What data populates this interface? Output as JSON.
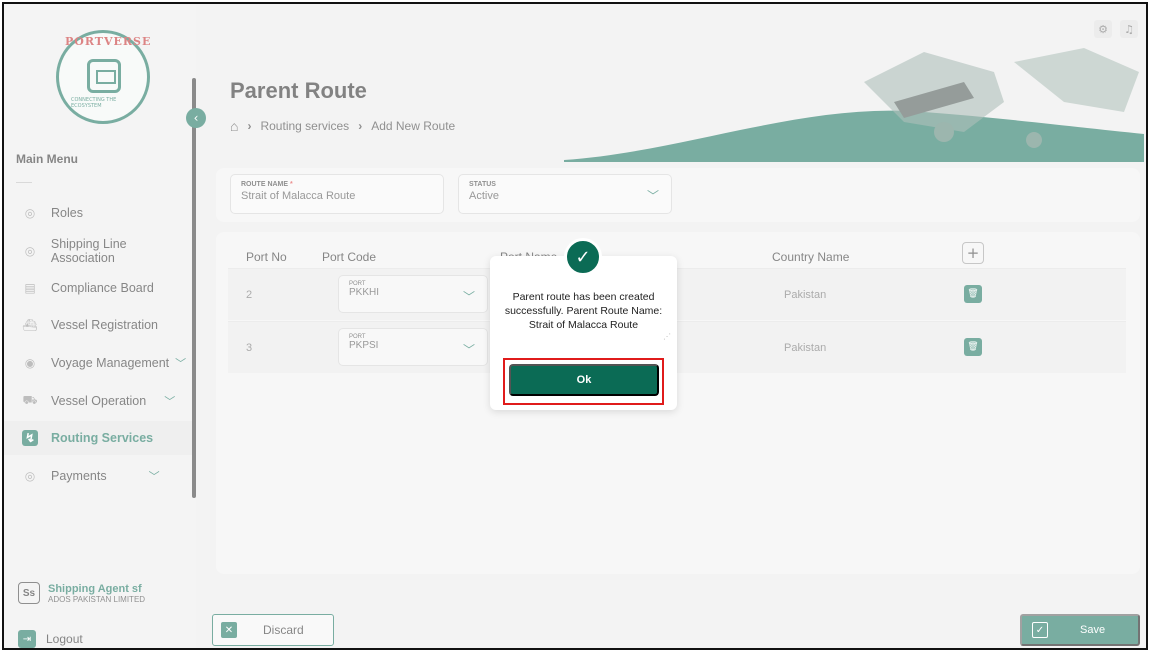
{
  "sidebar": {
    "logo_text": "PORTVERSE",
    "logo_tagline": "CONNECTING THE ECOSYSTEM",
    "main_menu": "Main Menu",
    "items": [
      {
        "label": "Roles",
        "icon": "roles-icon"
      },
      {
        "label": "Shipping Line Association",
        "icon": "association-icon"
      },
      {
        "label": "Compliance Board",
        "icon": "document-icon"
      },
      {
        "label": "Vessel Registration",
        "icon": "ship-icon"
      },
      {
        "label": "Voyage Management",
        "icon": "voyage-icon",
        "expandable": true
      },
      {
        "label": "Vessel Operation",
        "icon": "vessel-operation-icon",
        "expandable": true
      },
      {
        "label": "Routing Services",
        "icon": "route-icon",
        "active": true
      },
      {
        "label": "Payments",
        "icon": "payments-icon",
        "expandable": true
      }
    ],
    "agent": {
      "initials": "Ss",
      "title": "Shipping Agent sf",
      "company": "ADOS PAKISTAN LIMITED"
    },
    "logout": "Logout"
  },
  "header": {
    "title": "Parent Route",
    "breadcrumb": [
      "Routing services",
      "Add New Route"
    ]
  },
  "form": {
    "route_name_label": "ROUTE NAME",
    "route_name_value": "Strait of Malacca Route",
    "status_label": "STATUS",
    "status_value": "Active"
  },
  "table": {
    "columns": [
      "Port No",
      "Port Code",
      "Port Name",
      "Country Name"
    ],
    "rows": [
      {
        "port_no": "2",
        "port_label": "PORT",
        "port_code": "PKKHI",
        "country": "Pakistan"
      },
      {
        "port_no": "3",
        "port_label": "PORT",
        "port_code": "PKPSI",
        "country": "Pakistan"
      }
    ]
  },
  "actions": {
    "discard": "Discard",
    "save": "Save"
  },
  "modal": {
    "message": "Parent route has been created successfully. Parent Route Name: Strait of Malacca Route",
    "ok": "Ok"
  },
  "colors": {
    "accent": "#0b6b55",
    "highlight": "#e01b1b"
  }
}
